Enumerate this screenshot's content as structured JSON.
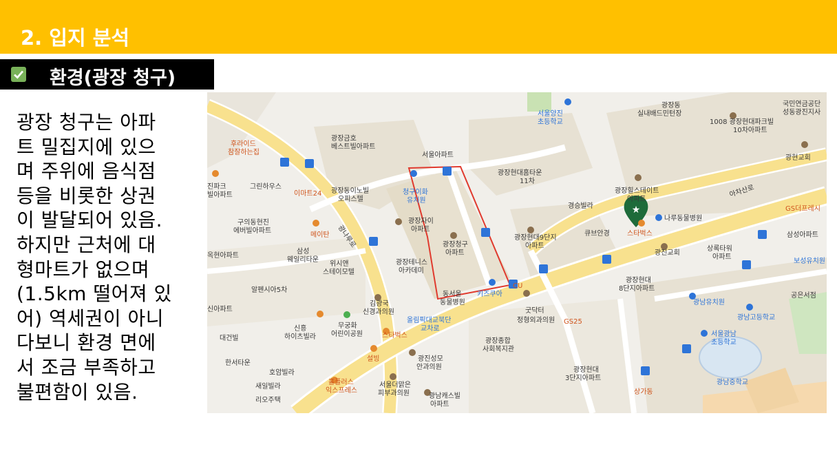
{
  "header": {
    "title": "2. 입지 분석"
  },
  "section": {
    "title": "환경(광장 청구)"
  },
  "description": {
    "lines": [
      "광장 청구는 아파",
      "트 밀집지에 있으",
      "며 주위에 음식점",
      "등을 비롯한 상권",
      "이 발달되어 있음.",
      "하지만 근처에 대",
      "형마트가 없으며",
      "(1.5km 떨어져 있",
      "어) 역세권이 아니",
      "다보니 환경 면에",
      "서 조금 부족하고",
      "불편함이 있음."
    ]
  },
  "map": {
    "labels": {
      "school1": "서울양진",
      "school1b": "초등학교",
      "gwangjang_dong": "광장동",
      "badminton": "실내배드민턴장",
      "apt1008": "1008 광장현대파크빌",
      "apt10": "10차아파트",
      "pension": "국민연금공단",
      "pension_b": "성동광진지사",
      "church1": "광현교회",
      "horide": "후라이드",
      "horide_b": "참잘하는집",
      "geumho": "광장금호",
      "geumho_b": "베스트빌아파트",
      "seoulapt": "서울아파트",
      "hyundai_11": "광장현대홈타운",
      "hyundai_11b": "11차",
      "hillstate": "광장힐스테이트",
      "hillstate_b": "아파트",
      "ajiro": "아차산로",
      "gs_fresh": "GS더프레시",
      "jinpark": "진파크",
      "jinpark_b": "빌아파트",
      "greenhouse": "그린하우스",
      "emart24": "이마트24",
      "dongi": "광장동이노빌",
      "dongi_b": "오피스텔",
      "kindergarten1": "청구이화",
      "kindergarten1b": "유치원",
      "gyeongseung": "경승빌라",
      "nuru": "나루동물병원",
      "guui": "구의동현진",
      "guui_b": "에버빌아파트",
      "meitan": "메이탄",
      "jai": "광장자이",
      "jai_b": "아파트",
      "cheonggu": "광장청구",
      "cheonggu_b": "아파트",
      "hyundai9": "광장현대9단지",
      "hyundai9_b": "아파트",
      "cube": "큐브안경",
      "starbucks": "스타벅스",
      "samsung_apt": "삼성아파트",
      "okhyeon": "옥현아파트",
      "samsung_wel": "삼성",
      "samsung_wel_b": "웨일리타운",
      "wisien": "위시앤",
      "wisien_b": "스테이모텔",
      "tennis": "광장테니스",
      "tennis_b": "아카데미",
      "church2": "광진교회",
      "sangrok": "상록타워",
      "sangrok_b": "아파트",
      "bosung": "보성유치원",
      "alhambra": "알펜시아5차",
      "dongseoul": "동서울",
      "dongseoul_b": "동물병원",
      "kids": "키즈쿠아",
      "cu": "CU",
      "hyundai8": "광장현대",
      "hyundai8_b": "8단지아파트",
      "gongeun": "공은서점",
      "sinapt": "신아파트",
      "gimkwang": "김광국",
      "gimkwang_b": "신경과의원",
      "olympic": "올림픽대교북단",
      "olympic_b": "교차로",
      "gooddoc": "굿닥터",
      "gooddoc_b": "정형외과의원",
      "gs25": "GS25",
      "gwangnam_kg": "광남유치원",
      "gwangnam_hs": "광남고등학교",
      "mugung": "무궁화",
      "mugung_b": "어린이공원",
      "sinheung": "신흥",
      "sinheung_b": "하이츠빌라",
      "gunbuilding": "대건빌",
      "starbucks2": "스타벅스",
      "welfare": "광장종합",
      "welfare_b": "사회복지관",
      "gwangnam_es": "서울광남",
      "gwangnam_es_b": "초등학교",
      "hanseo": "한서타운",
      "seolbing": "설빙",
      "gwangjin_sm": "광진성모",
      "gwangjin_sm_b": "안과의원",
      "hoam": "호암빌라",
      "saeil": "새일빌라",
      "riocity": "리오주택",
      "holly": "홀플러스",
      "holly_b": "익스프레스",
      "seoul_skin": "서울더맑은",
      "seoul_skin_b": "피부과의원",
      "gwangnam_castle": "광남캐스빌",
      "gwangnam_castle_b": "아파트",
      "hyundai3": "광장현대",
      "hyundai3_b": "3단지아파트",
      "sanggadong": "상가동",
      "gwangnam_ms": "광남중학교",
      "gwangnaru_ro": "광나루로"
    }
  },
  "colors": {
    "header": "#FFC000",
    "accent": "#FFC000",
    "check": "#78B159"
  }
}
